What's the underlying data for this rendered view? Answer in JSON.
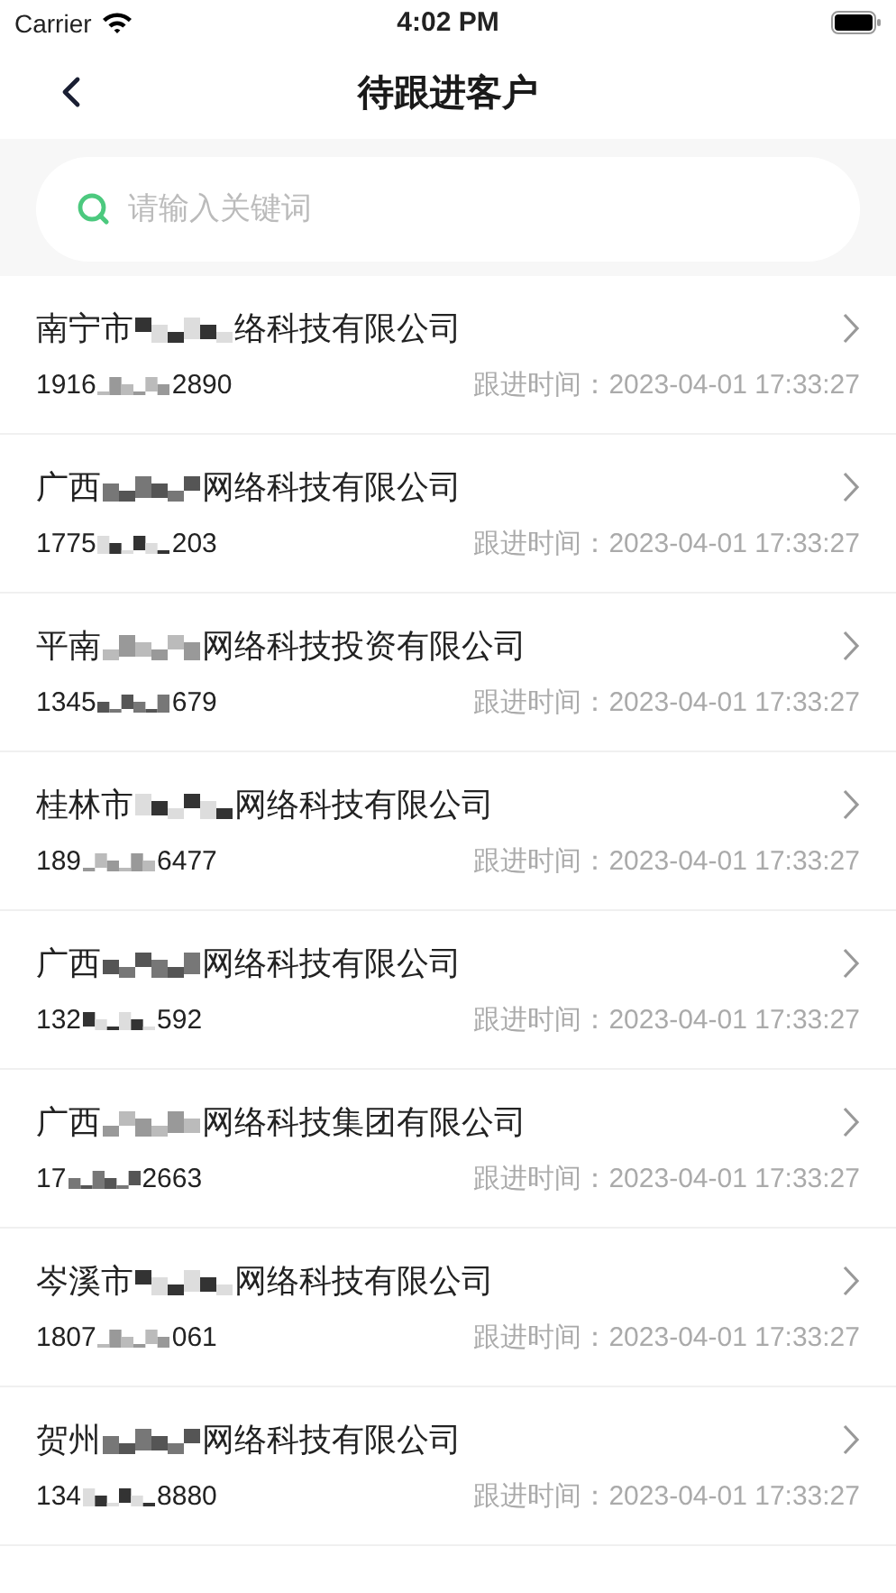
{
  "status_bar": {
    "carrier": "Carrier",
    "time": "4:02 PM"
  },
  "nav": {
    "title": "待跟进客户"
  },
  "search": {
    "placeholder": "请输入关键词"
  },
  "customers": [
    {
      "name_start": "南宁市",
      "name_end": "络科技有限公司",
      "phone_start": "1916",
      "phone_end": "2890",
      "follow_label": "跟进时间：",
      "follow_time": "2023-04-01 17:33:27"
    },
    {
      "name_start": "广西",
      "name_end": "网络科技有限公司",
      "phone_start": "1775",
      "phone_end": "203",
      "follow_label": "跟进时间：",
      "follow_time": "2023-04-01 17:33:27"
    },
    {
      "name_start": "平南",
      "name_end": "网络科技投资有限公司",
      "phone_start": "1345",
      "phone_end": "679",
      "follow_label": "跟进时间：",
      "follow_time": "2023-04-01 17:33:27"
    },
    {
      "name_start": "桂林市",
      "name_end": "网络科技有限公司",
      "phone_start": "189",
      "phone_end": "6477",
      "follow_label": "跟进时间：",
      "follow_time": "2023-04-01 17:33:27"
    },
    {
      "name_start": "广西",
      "name_end": "网络科技有限公司",
      "phone_start": "132",
      "phone_end": "592",
      "follow_label": "跟进时间：",
      "follow_time": "2023-04-01 17:33:27"
    },
    {
      "name_start": "广西",
      "name_end": "网络科技集团有限公司",
      "phone_start": "17",
      "phone_end": "2663",
      "follow_label": "跟进时间：",
      "follow_time": "2023-04-01 17:33:27"
    },
    {
      "name_start": "岑溪市",
      "name_end": "网络科技有限公司",
      "phone_start": "1807",
      "phone_end": "061",
      "follow_label": "跟进时间：",
      "follow_time": "2023-04-01 17:33:27"
    },
    {
      "name_start": "贺州",
      "name_end": "网络科技有限公司",
      "phone_start": "134",
      "phone_end": "8880",
      "follow_label": "跟进时间：",
      "follow_time": "2023-04-01 17:33:27"
    }
  ]
}
